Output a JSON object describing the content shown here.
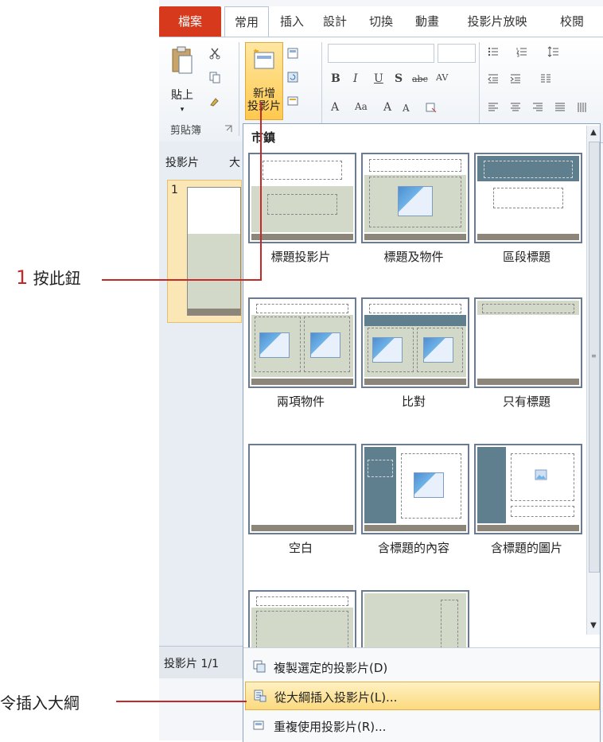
{
  "tabs": [
    "檔案",
    "常用",
    "插入",
    "設計",
    "切換",
    "動畫",
    "投影片放映",
    "校閱"
  ],
  "ribbon": {
    "paste_label": "貼上",
    "new_slide_label_1": "新增",
    "new_slide_label_2": "投影片",
    "clipboard_group": "剪貼簿"
  },
  "left_panel": {
    "tab_slides": "投影片",
    "tab_outline": "大",
    "slide_number": "1",
    "status_text": "投影片 1/1"
  },
  "gallery": {
    "theme_title": "市鎮",
    "layouts": [
      {
        "name": "標題投影片"
      },
      {
        "name": "標題及物件"
      },
      {
        "name": "區段標題"
      },
      {
        "name": "兩項物件"
      },
      {
        "name": "比對"
      },
      {
        "name": "只有標題"
      },
      {
        "name": "空白"
      },
      {
        "name": "含標題的內容"
      },
      {
        "name": "含標題的圖片"
      }
    ]
  },
  "menu": {
    "items": [
      {
        "label": "複製選定的投影片(D)"
      },
      {
        "label": "從大綱插入投影片(L)..."
      },
      {
        "label": "重複使用投影片(R)..."
      }
    ]
  },
  "annotations": {
    "step1_number": "1",
    "step1_text": "按此鈕",
    "step2_text": "令插入大綱"
  },
  "colors": {
    "file_tab": "#d6391c",
    "highlight": "#fbd97e",
    "layout_green": "#d3d9c9",
    "layout_teal": "#5f7f8f",
    "annotation_line": "#c62828"
  }
}
